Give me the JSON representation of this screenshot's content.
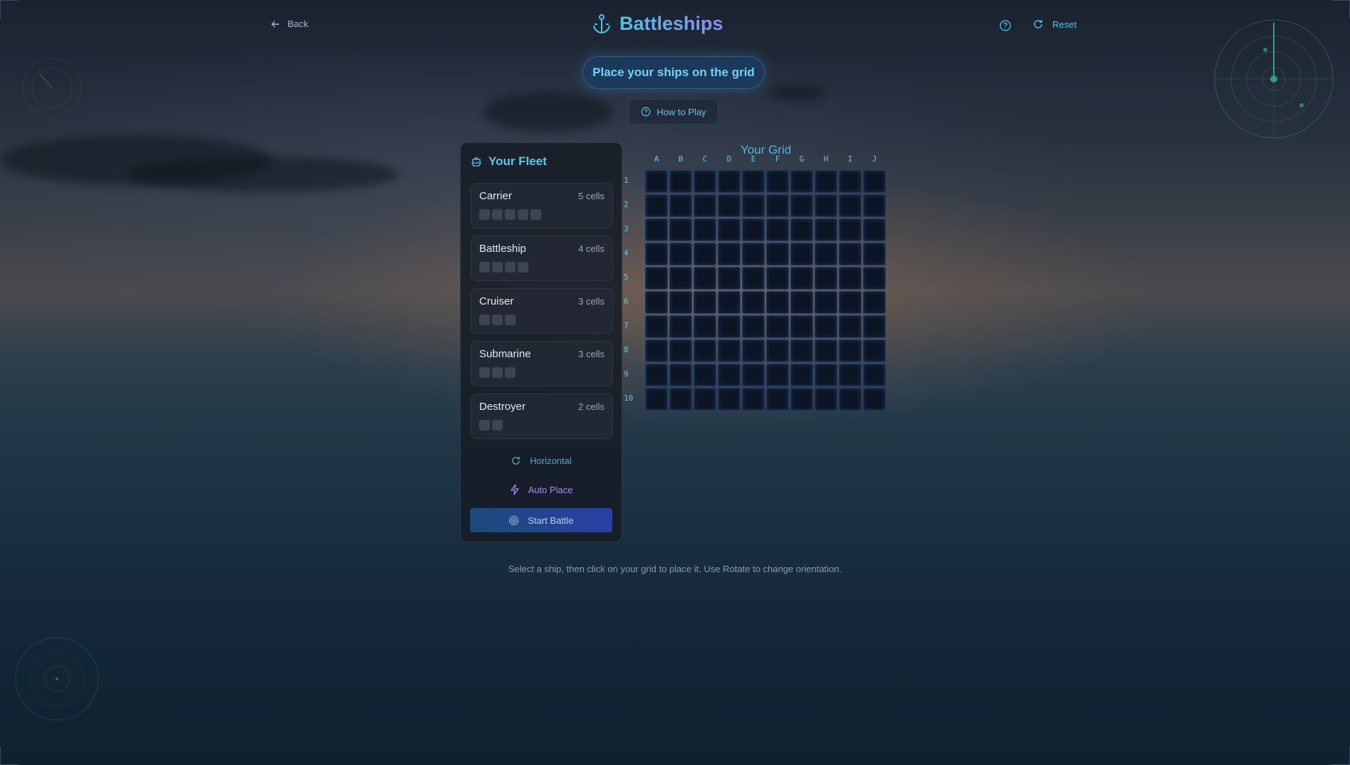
{
  "header": {
    "back_label": "Back",
    "title": "Battleships",
    "reset_label": "Reset"
  },
  "status": {
    "message": "Place your ships on the grid"
  },
  "howto": {
    "label": "How to Play"
  },
  "fleet": {
    "title": "Your Fleet",
    "ships": [
      {
        "name": "Carrier",
        "size_label": "5 cells",
        "cells": 5
      },
      {
        "name": "Battleship",
        "size_label": "4 cells",
        "cells": 4
      },
      {
        "name": "Cruiser",
        "size_label": "3 cells",
        "cells": 3
      },
      {
        "name": "Submarine",
        "size_label": "3 cells",
        "cells": 3
      },
      {
        "name": "Destroyer",
        "size_label": "2 cells",
        "cells": 2
      }
    ],
    "orientation_label": "Horizontal",
    "auto_place_label": "Auto Place",
    "start_label": "Start Battle"
  },
  "grid": {
    "title": "Your Grid",
    "columns": [
      "A",
      "B",
      "C",
      "D",
      "E",
      "F",
      "G",
      "H",
      "I",
      "J"
    ],
    "rows": [
      "1",
      "2",
      "3",
      "4",
      "5",
      "6",
      "7",
      "8",
      "9",
      "10"
    ]
  },
  "hint": "Select a ship, then click on your grid to place it. Use Rotate to change orientation.",
  "icons": {
    "back": "arrow-left-icon",
    "title": "anchor-icon",
    "help": "help-circle-icon",
    "reset": "refresh-icon",
    "howto": "help-circle-icon",
    "fleet": "ship-icon",
    "orientation": "rotate-icon",
    "auto_place": "lightning-icon",
    "start": "target-icon"
  },
  "colors": {
    "accent": "#4fc3e8",
    "title_gradient_end": "#8b8cf0",
    "auto_place": "#a98af5",
    "start_button": "#2a3fa6",
    "radar": "#2f8f6a"
  }
}
